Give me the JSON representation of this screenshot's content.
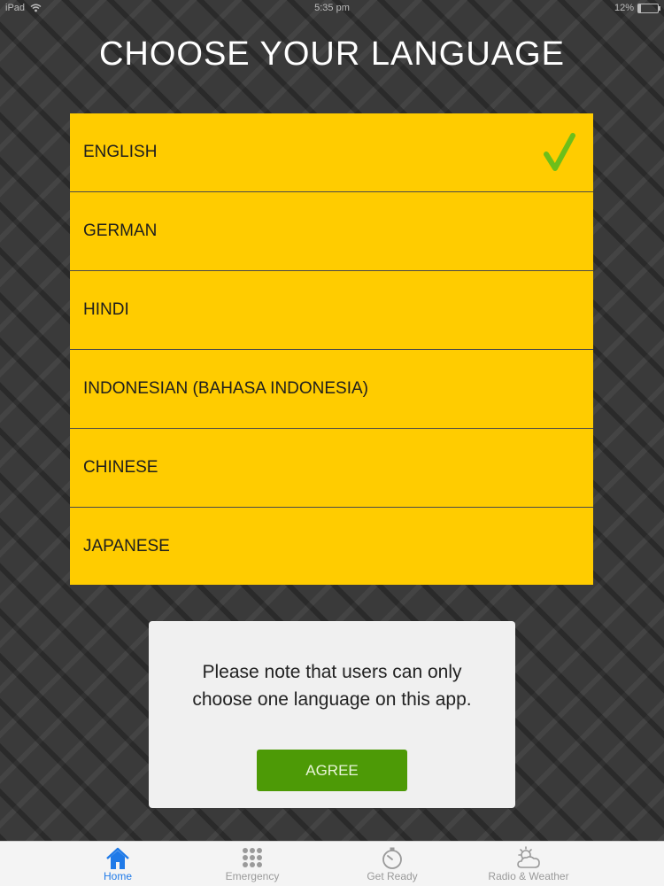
{
  "status_bar": {
    "device": "iPad",
    "time": "5:35 pm",
    "battery": "12%",
    "battery_level": 0.12
  },
  "title": "CHOOSE YOUR LANGUAGE",
  "languages": [
    {
      "label": "ENGLISH",
      "selected": true
    },
    {
      "label": "GERMAN",
      "selected": false
    },
    {
      "label": "HINDI",
      "selected": false
    },
    {
      "label": "INDONESIAN (BAHASA INDONESIA)",
      "selected": false
    },
    {
      "label": "CHINESE",
      "selected": false
    },
    {
      "label": "JAPANESE",
      "selected": false
    }
  ],
  "dialog": {
    "message": "Please note that users can only\nchoose one language on this app.",
    "agree_label": "AGREE"
  },
  "tabs": [
    {
      "label": "Home",
      "icon": "home-icon",
      "active": true
    },
    {
      "label": "Emergency",
      "icon": "grid-icon",
      "active": false
    },
    {
      "label": "Get Ready",
      "icon": "stopwatch-icon",
      "active": false
    },
    {
      "label": "Radio & Weather",
      "icon": "weather-icon",
      "active": false
    }
  ],
  "colors": {
    "list_bg": "#ffcc00",
    "check": "#6cbf1a",
    "agree_bg": "#4d9a06",
    "tab_active": "#1f7ae8",
    "tab_inactive": "#9a9a9a"
  }
}
